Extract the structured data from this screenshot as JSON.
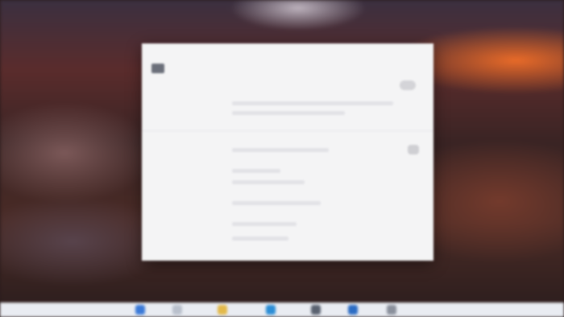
{
  "window": {
    "title": "",
    "tabs": [
      {
        "label": ""
      },
      {
        "label": ""
      }
    ],
    "section_heading": ""
  },
  "colors": {
    "window_bg": "#f4f4f5",
    "taskbar_bg": "#e9ecf2",
    "wallpaper_accent": "#f06e28"
  },
  "taskbar": {
    "icons": [
      "start-icon",
      "search-icon",
      "file-explorer-icon",
      "browser-icon",
      "store-icon",
      "mail-icon",
      "settings-icon"
    ]
  }
}
